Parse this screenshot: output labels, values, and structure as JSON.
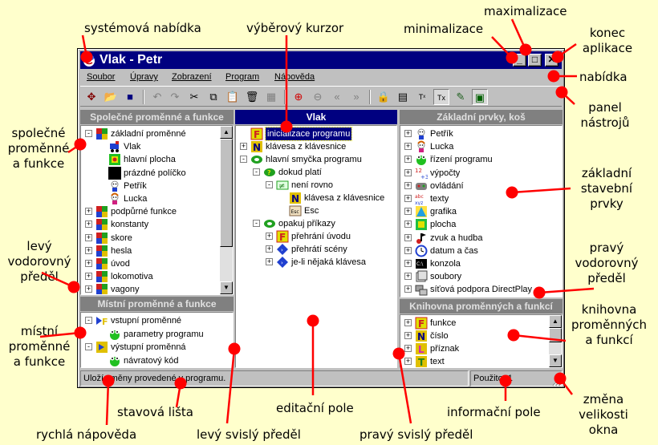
{
  "annotations": {
    "system_menu": "systémová nabídka",
    "selection_cursor": "výběrový kurzor",
    "minimize": "minimalizace",
    "maximize": "maximalizace",
    "close_line1": "konec",
    "close_line2": "aplikace",
    "menu": "nabídka",
    "toolbar_line1": "panel",
    "toolbar_line2": "nástrojů",
    "shared_line1": "společné",
    "shared_line2": "proměnné",
    "shared_line3": "a funkce",
    "basic_line1": "základní",
    "basic_line2": "stavební",
    "basic_line3": "prvky",
    "left_divider_line1": "levý",
    "left_divider_line2": "vodorovný",
    "left_divider_line3": "předěl",
    "right_divider_line1": "pravý",
    "right_divider_line2": "vodorovný",
    "right_divider_line3": "předěl",
    "local_line1": "místní",
    "local_line2": "proměnné",
    "local_line3": "a funkce",
    "library_line1": "knihovna",
    "library_line2": "proměnných",
    "library_line3": "a funkcí",
    "status_bar": "stavová lišta",
    "quick_help": "rychlá nápověda",
    "edit_pane": "editační pole",
    "left_splitter": "levý svislý předěl",
    "right_splitter": "pravý svislý předěl",
    "info_pane": "informační pole",
    "resize_line1": "změna",
    "resize_line2": "velikosti",
    "resize_line3": "okna"
  },
  "window": {
    "title": "Vlak - Petr",
    "menu": [
      "Soubor",
      "Úpravy",
      "Zobrazení",
      "Program",
      "Nápověda"
    ]
  },
  "panels": {
    "shared": "Společné proměnné a funkce",
    "local": "Místní proměnné a funkce",
    "editor": "Vlak",
    "basic": "Základní prvky, koš",
    "library": "Knihovna proměnných a funkcí"
  },
  "shared_tree": [
    "základní proměnné",
    "Vlak",
    "hlavní plocha",
    "prázdné políčko",
    "Petřík",
    "Lucka",
    "podpůrné funkce",
    "konstanty",
    "skore",
    "hesla",
    "úvod",
    "lokomotiva",
    "vagony"
  ],
  "local_tree": [
    "vstupní proměnné",
    "parametry programu",
    "výstupní proměnná",
    "návratový kód"
  ],
  "editor_tree": [
    "inicializace programu",
    "klávesa z klávesnice",
    "hlavní smyčka programu",
    "dokud platí",
    "není rovno",
    "klávesa z klávesnice",
    "Esc",
    "opakuj příkazy",
    "přehrání úvodu",
    "přehrátí scény",
    "je-li nějaká klávesa"
  ],
  "basic_tree": [
    "Petřík",
    "Lucka",
    "řízení programu",
    "výpočty",
    "ovládání",
    "texty",
    "grafika",
    "plocha",
    "zvuk a hudba",
    "datum a čas",
    "konzola",
    "soubory",
    "síťová podpora DirectPlay"
  ],
  "library_tree": [
    "funkce",
    "číslo",
    "příznak",
    "text"
  ],
  "status": {
    "help_text": "Uloží změny provedené v programu.",
    "info_text": "Použito: 1"
  },
  "colors": {
    "background": "#ffffcc",
    "titlebar": "#000080",
    "arrow": "#ff0000"
  }
}
